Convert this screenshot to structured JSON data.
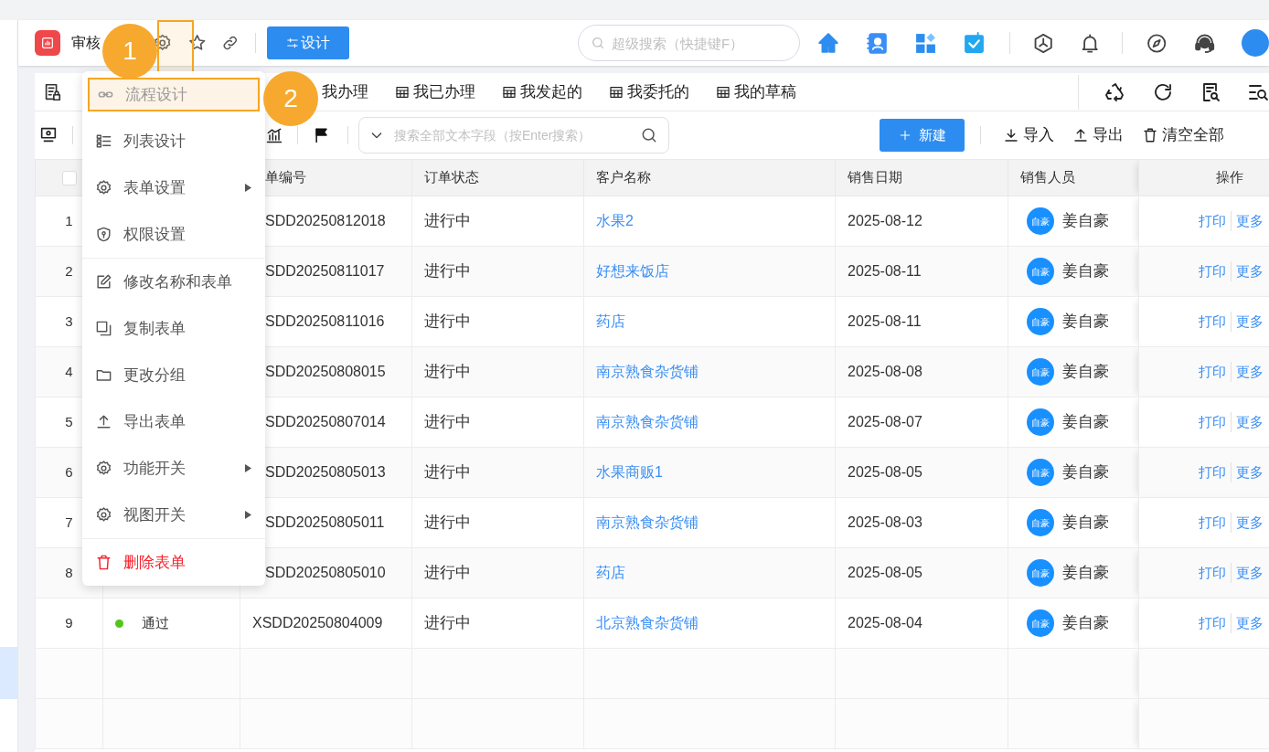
{
  "app": {
    "title": "审核",
    "design_button": "设计",
    "search_placeholder": "超级搜索（快捷键F）"
  },
  "annotations": [
    {
      "label": "1"
    },
    {
      "label": "2"
    }
  ],
  "view_tabs": [
    {
      "label": "我办理"
    },
    {
      "label": "我已办理"
    },
    {
      "label": "我发起的"
    },
    {
      "label": "我委托的"
    },
    {
      "label": "我的草稿"
    }
  ],
  "toolbar": {
    "search_placeholder": "搜索全部文本字段（按Enter搜索）",
    "new_button": "新建",
    "actions": [
      "导入",
      "导出",
      "清空全部"
    ]
  },
  "table": {
    "select_all_checked": false,
    "columns": [
      "单编号",
      "订单状态",
      "客户名称",
      "销售日期",
      "销售人员",
      "操作"
    ],
    "rows": [
      {
        "index": "1",
        "order_no": "SDD20250812018",
        "order_status": "进行中",
        "customer": "水果2",
        "date": "2025-08-12",
        "avatar": "自豪",
        "salesperson": "姜自豪",
        "actions": [
          "打印",
          "更多"
        ]
      },
      {
        "index": "2",
        "order_no": "SDD20250811017",
        "order_status": "进行中",
        "customer": "好想来饭店",
        "date": "2025-08-11",
        "avatar": "自豪",
        "salesperson": "姜自豪",
        "actions": [
          "打印",
          "更多"
        ]
      },
      {
        "index": "3",
        "order_no": "SDD20250811016",
        "order_status": "进行中",
        "customer": "药店",
        "date": "2025-08-11",
        "avatar": "自豪",
        "salesperson": "姜自豪",
        "actions": [
          "打印",
          "更多"
        ]
      },
      {
        "index": "4",
        "order_no": "SDD20250808015",
        "order_status": "进行中",
        "customer": "南京熟食杂货铺",
        "date": "2025-08-08",
        "avatar": "自豪",
        "salesperson": "姜自豪",
        "actions": [
          "打印",
          "更多"
        ]
      },
      {
        "index": "5",
        "order_no": "SDD20250807014",
        "order_status": "进行中",
        "customer": "南京熟食杂货铺",
        "date": "2025-08-07",
        "avatar": "自豪",
        "salesperson": "姜自豪",
        "actions": [
          "打印",
          "更多"
        ]
      },
      {
        "index": "6",
        "order_no": "SDD20250805013",
        "order_status": "进行中",
        "customer": "水果商贩1",
        "date": "2025-08-05",
        "avatar": "自豪",
        "salesperson": "姜自豪",
        "actions": [
          "打印",
          "更多"
        ]
      },
      {
        "index": "7",
        "order_no": "SDD20250805011",
        "order_status": "进行中",
        "customer": "南京熟食杂货铺",
        "date": "2025-08-03",
        "avatar": "自豪",
        "salesperson": "姜自豪",
        "actions": [
          "打印",
          "更多"
        ]
      },
      {
        "index": "8",
        "order_no": "SDD20250805010",
        "order_status": "进行中",
        "customer": "药店",
        "date": "2025-08-05",
        "avatar": "自豪",
        "salesperson": "姜自豪",
        "actions": [
          "打印",
          "更多"
        ]
      },
      {
        "index": "9",
        "review_status": "通过",
        "color": "#52c41a",
        "order_no": "XSDD20250804009",
        "order_status": "进行中",
        "customer": "北京熟食杂货铺",
        "date": "2025-08-04",
        "avatar": "自豪",
        "salesperson": "姜自豪",
        "actions": [
          "打印",
          "更多"
        ]
      }
    ]
  },
  "menu": {
    "groups": [
      [
        {
          "label": "流程设计",
          "selected": true,
          "submenu": false,
          "kind": "normal"
        },
        {
          "label": "列表设计",
          "selected": false,
          "submenu": false,
          "kind": "normal"
        },
        {
          "label": "表单设置",
          "selected": false,
          "submenu": true,
          "kind": "normal"
        },
        {
          "label": "权限设置",
          "selected": false,
          "submenu": false,
          "kind": "normal"
        }
      ],
      [
        {
          "label": "修改名称和表单",
          "selected": false,
          "submenu": false,
          "kind": "normal"
        },
        {
          "label": "复制表单",
          "selected": false,
          "submenu": false,
          "kind": "normal"
        },
        {
          "label": "更改分组",
          "selected": false,
          "submenu": false,
          "kind": "normal"
        },
        {
          "label": "导出表单",
          "selected": false,
          "submenu": false,
          "kind": "normal"
        },
        {
          "label": "功能开关",
          "selected": false,
          "submenu": true,
          "kind": "normal"
        },
        {
          "label": "视图开关",
          "selected": false,
          "submenu": true,
          "kind": "normal"
        }
      ],
      [
        {
          "label": "删除表单",
          "selected": false,
          "submenu": false,
          "kind": "danger"
        }
      ]
    ]
  }
}
